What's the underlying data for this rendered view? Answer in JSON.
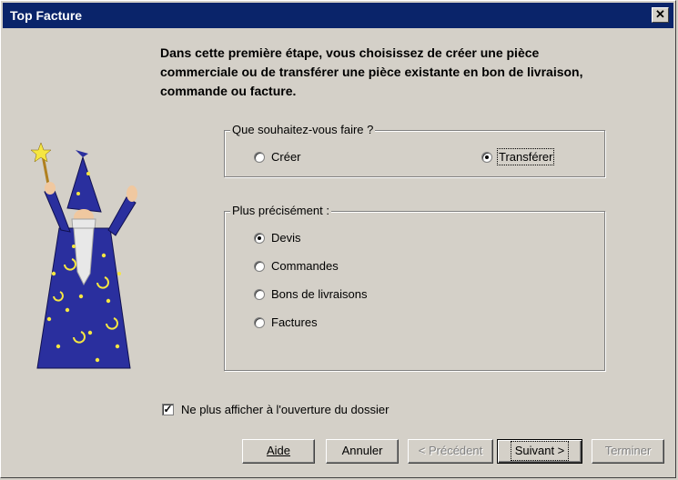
{
  "window": {
    "title": "Top Facture",
    "close_glyph": "✕"
  },
  "intro_text": "Dans cette première étape, vous choisissez de créer une pièce\ncommerciale ou de transférer une pièce existante en bon de livraison,\ncommande ou facture.",
  "action_group": {
    "title": "Que souhaitez-vous faire ?",
    "options": [
      {
        "label": "Créer",
        "selected": false
      },
      {
        "label": "Transférer",
        "selected": true
      }
    ]
  },
  "detail_group": {
    "title": "Plus précisément :",
    "options": [
      {
        "label": "Devis",
        "selected": true
      },
      {
        "label": "Commandes",
        "selected": false
      },
      {
        "label": "Bons de livraisons",
        "selected": false
      },
      {
        "label": "Factures",
        "selected": false
      }
    ]
  },
  "dont_show": {
    "label": "Ne plus afficher à l'ouverture du dossier",
    "checked": true
  },
  "buttons": {
    "help": "Aide",
    "cancel": "Annuler",
    "previous": "< Précédent",
    "next": "Suivant >",
    "finish": "Terminer"
  },
  "colors": {
    "titlebar": "#0a246a",
    "face": "#d4d0c8",
    "robe": "#2a2f9e",
    "stars": "#f5e642"
  },
  "illustration": "wizard-icon"
}
